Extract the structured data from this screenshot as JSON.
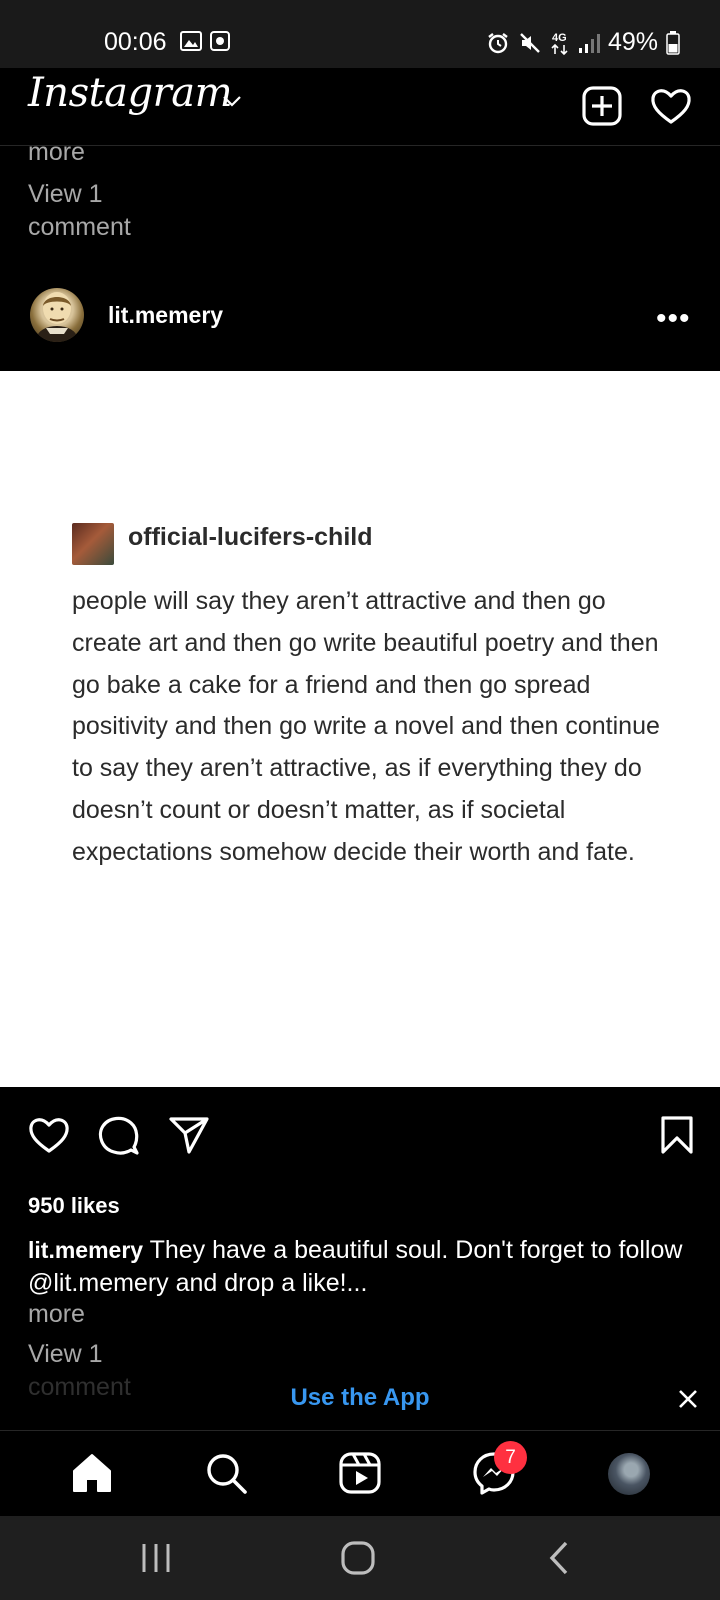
{
  "status_bar": {
    "time": "00:06",
    "battery": "49%",
    "left_icons": [
      "image-icon",
      "screen-record-icon"
    ],
    "right_icons": [
      "alarm-icon",
      "mute-icon",
      "4g-icon",
      "signal-icon",
      "battery-icon"
    ]
  },
  "header": {
    "logo": "Instagram",
    "icons": [
      "chevron-down-icon",
      "add-post-icon",
      "heart-icon"
    ]
  },
  "previous_post": {
    "more": "more",
    "view_comments": "View 1 comment"
  },
  "post": {
    "username": "lit.memery",
    "menu": "•••",
    "image": {
      "tumblr_username": "official-lucifers-child",
      "tumblr_text": "people will say they aren’t attractive and then go create art and then go write beautiful poetry and then go bake a cake for a friend and then go spread positivity and then go write a novel and then continue to say they aren’t attractive, as if everything they do doesn’t count or doesn’t matter, as if societal expectations somehow decide their worth and fate."
    },
    "likes": "950 likes",
    "caption_user": "lit.memery",
    "caption_text": "They have a beautiful soul. Don't forget to follow @lit.memery and drop a like!...",
    "more": "more",
    "view_comments": "View 1",
    "comment_word": "comment"
  },
  "banner": {
    "use_app": "Use the App"
  },
  "bottom_nav": {
    "items": [
      "home-icon",
      "search-icon",
      "reels-icon",
      "messenger-icon",
      "profile-avatar"
    ],
    "messenger_badge": "7"
  },
  "colors": {
    "background": "#000000",
    "link_blue": "#3897f0",
    "badge_red": "#ff3040",
    "muted_text": "#a8a8a8"
  }
}
